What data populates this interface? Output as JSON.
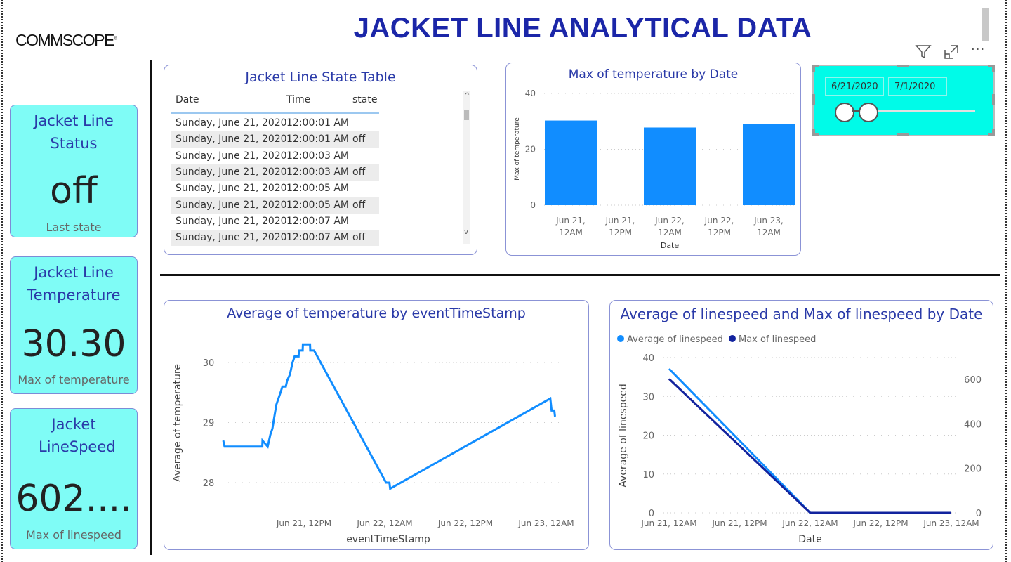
{
  "header": {
    "logo": "COMMSCOPE",
    "title": "JACKET LINE ANALYTICAL DATA"
  },
  "toolbar": {
    "icons": [
      "filter-icon",
      "focus-mode-icon",
      "more-options-icon"
    ]
  },
  "cards": [
    {
      "title": "Jacket Line Status",
      "value": "off",
      "label": "Last state"
    },
    {
      "title": "Jacket Line Temperature",
      "value": "30.30",
      "label": "Max of temperature"
    },
    {
      "title": "Jacket LineSpeed",
      "value": "602....",
      "label": "Max of linespeed"
    }
  ],
  "state_table": {
    "title": "Jacket Line State Table",
    "columns": [
      "Date",
      "Time",
      "state"
    ],
    "rows": [
      [
        "Sunday, June 21, 2020",
        "12:00:01 AM",
        ""
      ],
      [
        "Sunday, June 21, 2020",
        "12:00:01 AM",
        "off"
      ],
      [
        "Sunday, June 21, 2020",
        "12:00:03 AM",
        ""
      ],
      [
        "Sunday, June 21, 2020",
        "12:00:03 AM",
        "off"
      ],
      [
        "Sunday, June 21, 2020",
        "12:00:05 AM",
        ""
      ],
      [
        "Sunday, June 21, 2020",
        "12:00:05 AM",
        "off"
      ],
      [
        "Sunday, June 21, 2020",
        "12:00:07 AM",
        ""
      ],
      [
        "Sunday, June 21, 2020",
        "12:00:07 AM",
        "off"
      ]
    ]
  },
  "date_slicer": {
    "start": "6/21/2020",
    "end": "7/1/2020",
    "background": "#00fbe8"
  },
  "colors": {
    "accent": "#1b26a8",
    "bar": "#118dff",
    "line_light": "#118dff",
    "line_dark": "#12239e",
    "card_bg": "#7ffcf6"
  },
  "chart_data": [
    {
      "type": "bar",
      "title": "Max of temperature by Date",
      "xlabel": "Date",
      "ylabel": "Max of temperature",
      "ylim": [
        0,
        40
      ],
      "yticks": [
        0,
        20,
        40
      ],
      "xticks": [
        "Jun 21, 12AM",
        "Jun 21, 12PM",
        "Jun 22, 12AM",
        "Jun 22, 12PM",
        "Jun 23, 12AM"
      ],
      "categories": [
        "2020-06-21",
        "2020-06-22",
        "2020-06-23"
      ],
      "values": [
        30.3,
        27.8,
        29.1
      ],
      "grid": true
    },
    {
      "type": "line",
      "title": "Average of temperature by eventTimeStamp",
      "xlabel": "eventTimeStamp",
      "ylabel": "Average of temperature",
      "yticks": [
        28,
        29,
        30
      ],
      "xticks": [
        "Jun 21, 12PM",
        "Jun 22, 12AM",
        "Jun 22, 12PM",
        "Jun 23, 12AM"
      ],
      "grid": true,
      "points": [
        [
          "2020-06-21T00:00",
          28.7
        ],
        [
          "2020-06-21T00:12",
          28.6
        ],
        [
          "2020-06-21T05:48",
          28.6
        ],
        [
          "2020-06-21T05:50",
          28.7
        ],
        [
          "2020-06-21T06:36",
          28.6
        ],
        [
          "2020-06-21T06:48",
          28.7
        ],
        [
          "2020-06-21T07:00",
          28.8
        ],
        [
          "2020-06-21T07:18",
          28.9
        ],
        [
          "2020-06-21T07:36",
          29.1
        ],
        [
          "2020-06-21T07:54",
          29.3
        ],
        [
          "2020-06-21T08:12",
          29.4
        ],
        [
          "2020-06-21T08:30",
          29.5
        ],
        [
          "2020-06-21T08:48",
          29.6
        ],
        [
          "2020-06-21T09:18",
          29.6
        ],
        [
          "2020-06-21T09:30",
          29.7
        ],
        [
          "2020-06-21T09:54",
          29.8
        ],
        [
          "2020-06-21T10:06",
          29.9
        ],
        [
          "2020-06-21T10:18",
          30.0
        ],
        [
          "2020-06-21T10:36",
          30.1
        ],
        [
          "2020-06-21T11:12",
          30.1
        ],
        [
          "2020-06-21T11:14",
          30.2
        ],
        [
          "2020-06-21T11:48",
          30.2
        ],
        [
          "2020-06-21T11:50",
          30.3
        ],
        [
          "2020-06-21T12:54",
          30.3
        ],
        [
          "2020-06-21T12:56",
          30.2
        ],
        [
          "2020-06-21T13:30",
          30.2
        ],
        [
          "2020-06-22T00:12",
          28.0
        ],
        [
          "2020-06-22T00:42",
          28.0
        ],
        [
          "2020-06-22T00:48",
          27.9
        ],
        [
          "2020-06-23T00:36",
          29.4
        ],
        [
          "2020-06-23T00:48",
          29.2
        ],
        [
          "2020-06-23T01:12",
          29.2
        ],
        [
          "2020-06-23T01:18",
          29.1
        ]
      ]
    },
    {
      "type": "line",
      "title": "Average of linespeed and Max of linespeed by Date",
      "xlabel": "Date",
      "ylabel": "Average of linespeed",
      "yticks_left": [
        0,
        10,
        20,
        30,
        40
      ],
      "yticks_right": [
        0,
        200,
        400,
        600
      ],
      "xticks": [
        "Jun 21, 12AM",
        "Jun 21, 12PM",
        "Jun 22, 12AM",
        "Jun 22, 12PM",
        "Jun 23, 12AM"
      ],
      "legend_position": "top-left",
      "grid": true,
      "x": [
        "2020-06-21",
        "2020-06-22",
        "2020-06-23"
      ],
      "series": [
        {
          "name": "Average of linespeed",
          "axis": "left",
          "values": [
            37.1,
            0,
            0
          ]
        },
        {
          "name": "Max of linespeed",
          "axis": "right",
          "values": [
            602,
            0,
            0
          ]
        }
      ]
    }
  ]
}
